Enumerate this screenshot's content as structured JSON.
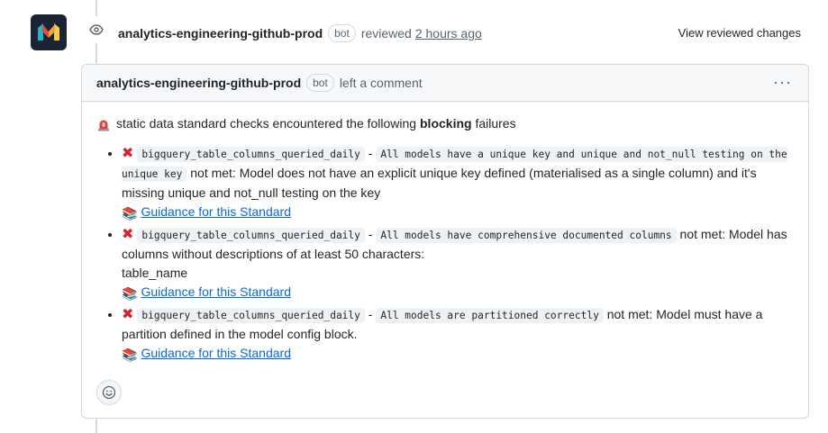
{
  "event": {
    "author": "analytics-engineering-github-prod",
    "badge": "bot",
    "action": "reviewed",
    "time": "2 hours ago",
    "view_changes": "View reviewed changes"
  },
  "comment": {
    "author": "analytics-engineering-github-prod",
    "badge": "bot",
    "action": "left a comment",
    "menu": "···",
    "intro_before": "static data standard checks encountered the following",
    "intro_bold": "blocking",
    "intro_after": "failures",
    "items": [
      {
        "table": "bigquery_table_columns_queried_daily",
        "sep": "-",
        "standard": "All models have a unique key and unique and not_null testing on the unique key",
        "message": "not met: Model does not have an explicit unique key defined (materialised as a single column) and it's missing unique and not_null testing on the key",
        "extra": "",
        "link": "Guidance for this Standard"
      },
      {
        "table": "bigquery_table_columns_queried_daily",
        "sep": "-",
        "standard": "All models have comprehensive documented columns",
        "message": "not met: Model has columns without descriptions of at least 50 characters:",
        "extra": "table_name",
        "link": "Guidance for this Standard"
      },
      {
        "table": "bigquery_table_columns_queried_daily",
        "sep": "-",
        "standard": "All models are partitioned correctly",
        "message": "not met: Model must have a partition defined in the model config block.",
        "extra": "",
        "link": "Guidance for this Standard"
      }
    ]
  },
  "icons": {
    "avatar": "monzo-logo",
    "event": "eye-icon",
    "siren": "rotating-light-icon",
    "x": "cross-mark-icon",
    "books": "books-icon",
    "reaction": "smiley-icon"
  },
  "colors": {
    "link": "#0969da",
    "x": "#d1242f",
    "muted": "#59636e"
  }
}
